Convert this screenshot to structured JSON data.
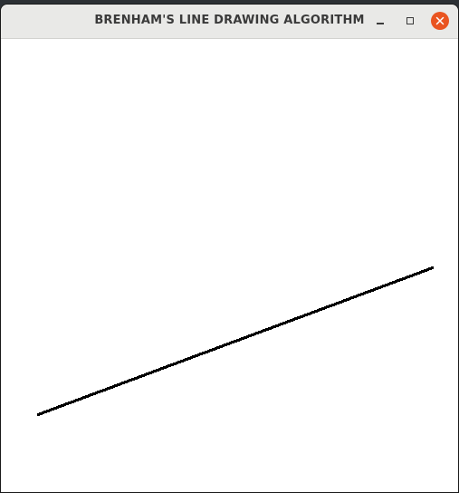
{
  "window": {
    "title": "BRENHAM'S LINE DRAWING ALGORITHM",
    "controls": {
      "minimize": "minimize-icon",
      "maximize": "maximize-icon",
      "close": "close-icon",
      "close_color": "#e95420"
    }
  },
  "canvas": {
    "background": "#ffffff",
    "line_color": "#000000"
  }
}
